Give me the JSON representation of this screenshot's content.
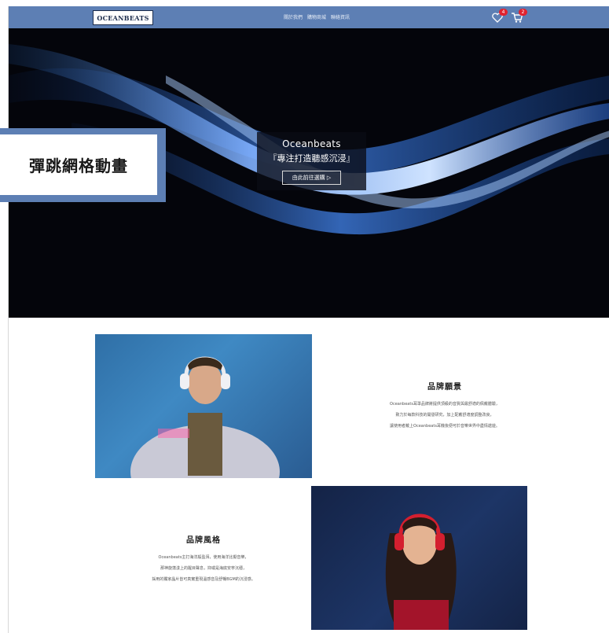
{
  "header": {
    "logo": "OCEANBEATS",
    "nav": [
      "關於我們",
      "購物商城",
      "聯絡資訊"
    ],
    "wishlist_count": "4",
    "cart_count": "2"
  },
  "hero": {
    "brand": "Oceanbeats",
    "slogan": "『專注打造聽感沉浸』",
    "cta": "由此前往選購 ▷"
  },
  "overlay": {
    "label": "彈跳網格動畫"
  },
  "vision": {
    "title": "品牌願景",
    "lines": [
      "Oceanbeats耳罩品牌將提供頂級的音質與最舒適的佩戴體驗，",
      "致力於每款科技的開發研究，加上配戴舒適度調整改良，",
      "讓使用者戴上Oceanbeats耳機後便可於音樂世界中盡情遨遊。"
    ]
  },
  "style": {
    "title": "品牌風格",
    "lines": [
      "Oceanbeats主打海洋般盈湃，使用海洋比擬音樂，",
      "那神旋蕩漾上的醒目聲息，抑或是海底安寧沉穩，",
      "採用的獨家晶片皆可真實重現溫感音及舒暢BGM的沉浸感。"
    ]
  },
  "colors": {
    "header": "#5d7fb4",
    "badge": "#e0232f",
    "hero_bg": "#04050b"
  }
}
